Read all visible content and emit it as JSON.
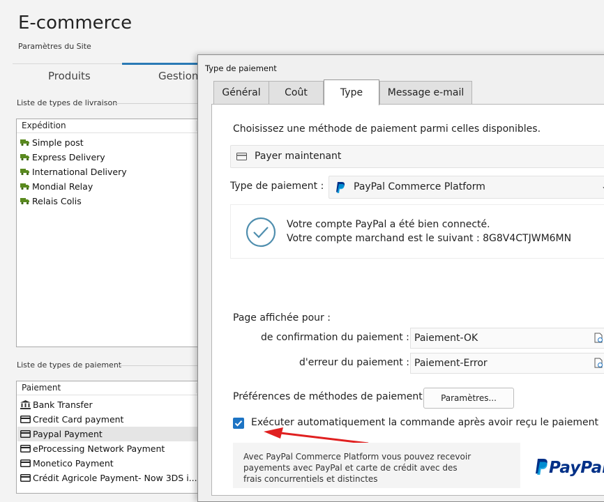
{
  "app": {
    "title": "E-commerce",
    "subtitle": "Paramètres du Site"
  },
  "main_tabs": [
    {
      "label": "Produits"
    },
    {
      "label": "Gestion"
    }
  ],
  "shipping": {
    "section_label": "Liste de types de livraison",
    "column_header": "Expédition",
    "items": [
      {
        "label": "Simple post",
        "icon": "truck-icon"
      },
      {
        "label": "Express Delivery",
        "icon": "truck-icon"
      },
      {
        "label": "International Delivery",
        "icon": "truck-icon"
      },
      {
        "label": "Mondial Relay",
        "icon": "truck-icon"
      },
      {
        "label": "Relais Colis",
        "icon": "truck-icon"
      }
    ]
  },
  "payment": {
    "section_label": "Liste de types de paiement",
    "column_header": "Paiement",
    "items": [
      {
        "label": "Bank Transfer",
        "icon": "bank-icon"
      },
      {
        "label": "Credit Card payment",
        "icon": "card-icon"
      },
      {
        "label": "Paypal Payment",
        "icon": "card-icon",
        "selected": true
      },
      {
        "label": "eProcessing Network Payment",
        "icon": "card-icon"
      },
      {
        "label": "Monetico Payment",
        "icon": "card-icon"
      },
      {
        "label": "Crédit Agricole  Payment- Now 3DS i...",
        "icon": "card-icon"
      }
    ]
  },
  "dialog": {
    "title": "Type de paiement",
    "tabs": [
      {
        "label": "Général"
      },
      {
        "label": "Coût"
      },
      {
        "label": "Type",
        "active": true
      },
      {
        "label": "Message e-mail"
      }
    ],
    "intro": "Choisissez une méthode de paiement parmi celles disponibles.",
    "method_value": "Payer maintenant",
    "type_label": "Type de paiement :",
    "type_value": "PayPal Commerce Platform",
    "status_line1": "Votre compte PayPal a été bien connecté.",
    "status_line2": "Votre compte marchand est le suivant : 8G8V4CTJWM6MN",
    "page_shown_label": "Page affichée pour :",
    "confirm_label": "de confirmation du paiement :",
    "confirm_value": "Paiement-OK",
    "error_label": "d'erreur du paiement :",
    "error_value": "Paiement-Error",
    "prefs_label": "Préférences de méthodes de paiement :",
    "prefs_button": "Paramètres...",
    "auto_execute_label": "Exécuter automatiquement la commande après avoir reçu le paiement",
    "auto_execute_checked": true,
    "info_text": "Avec PayPal Commerce Platform vous pouvez recevoir payements avec PayPal et carte de crédit avec des frais concurrentiels et distinctes",
    "paypal_logo": "PayPal"
  },
  "colors": {
    "accent": "#2a7ab5",
    "truck": "#5a8a1f",
    "checkbox": "#1d74c4",
    "arrow": "#e02020",
    "paypal_dark": "#003087",
    "paypal_light": "#009cde"
  }
}
